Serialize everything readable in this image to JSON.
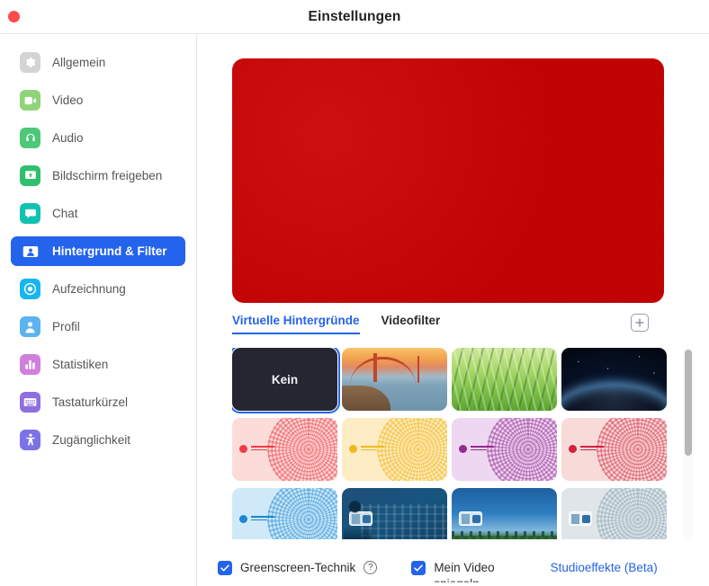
{
  "window": {
    "title": "Einstellungen",
    "close_button": "close"
  },
  "sidebar": {
    "items": [
      {
        "label": "Allgemein",
        "icon": "gear-icon",
        "color": "#d4d4d6"
      },
      {
        "label": "Video",
        "icon": "video-icon",
        "color": "#8fd479"
      },
      {
        "label": "Audio",
        "icon": "headphones-icon",
        "color": "#4cc878"
      },
      {
        "label": "Bildschirm freigeben",
        "icon": "share-screen-icon",
        "color": "#2fbf6f"
      },
      {
        "label": "Chat",
        "icon": "chat-bubble-icon",
        "color": "#12c2b0"
      },
      {
        "label": "Hintergrund & Filter",
        "icon": "background-person-icon",
        "color": "#2463eb",
        "active": true
      },
      {
        "label": "Aufzeichnung",
        "icon": "record-icon",
        "color": "#18b6f0"
      },
      {
        "label": "Profil",
        "icon": "person-icon",
        "color": "#5ab4ef"
      },
      {
        "label": "Statistiken",
        "icon": "bar-chart-icon",
        "color": "#d07fdc"
      },
      {
        "label": "Tastaturkürzel",
        "icon": "keyboard-icon",
        "color": "#8e6fe0"
      },
      {
        "label": "Zugänglichkeit",
        "icon": "accessibility-icon",
        "color": "#7b72e8"
      }
    ]
  },
  "main": {
    "preview": {
      "background_color": "#cc0000",
      "alt": "video-preview-red"
    },
    "tabs": [
      {
        "label": "Virtuelle Hintergründe",
        "active": true
      },
      {
        "label": "Videofilter",
        "active": false
      }
    ],
    "add_button": "+",
    "backgrounds": [
      {
        "name": "Kein",
        "kind": "none",
        "selected": true
      },
      {
        "name": "golden-gate-bridge",
        "kind": "scenic",
        "style": "sc-bridge"
      },
      {
        "name": "grass-dew",
        "kind": "scenic",
        "style": "sc-grass"
      },
      {
        "name": "earth-from-space",
        "kind": "scenic",
        "style": "sc-earth"
      },
      {
        "name": "university-seal-red",
        "kind": "seal",
        "bg": "#fbdcd8",
        "ink": "#ef3c49"
      },
      {
        "name": "university-seal-gold",
        "kind": "seal",
        "bg": "#fdecc4",
        "ink": "#f0b81c"
      },
      {
        "name": "university-seal-purple",
        "kind": "seal",
        "bg": "#eed7f0",
        "ink": "#942a93"
      },
      {
        "name": "university-seal-crimson",
        "kind": "seal",
        "bg": "#f8dad9",
        "ink": "#d2213f"
      },
      {
        "name": "university-seal-lightblue",
        "kind": "seal",
        "bg": "#cfe9f8",
        "ink": "#1a87d1"
      },
      {
        "name": "campus-building-blue",
        "kind": "scenic",
        "style": "sc-building",
        "badge": true
      },
      {
        "name": "city-skyline-blue",
        "kind": "scenic",
        "style": "sc-skyline",
        "badge": true
      },
      {
        "name": "university-seal-grey",
        "kind": "seal",
        "bg": "#dfe5e8",
        "ink": "#9fb4c0",
        "badge": true
      }
    ],
    "scrollbar": {
      "visible": true
    }
  },
  "footer": {
    "greenscreen": {
      "label": "Greenscreen-Technik",
      "checked": true,
      "help": "?"
    },
    "my_video": {
      "label": "Mein Video",
      "sub_label": "spiegeln",
      "checked": true
    },
    "studio_effects_link": "Studioeffekte (Beta)"
  },
  "colors": {
    "accent": "#2463eb",
    "preview": "#cc0000",
    "text": "#2b2b2b",
    "muted": "#565656"
  }
}
